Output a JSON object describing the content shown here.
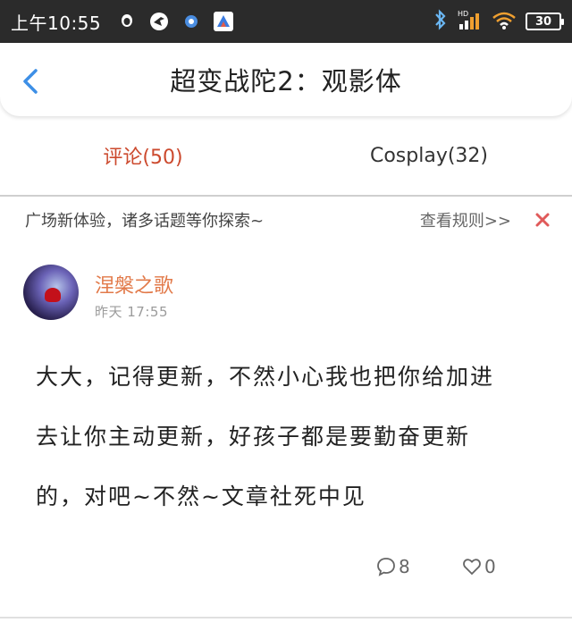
{
  "status_bar": {
    "time": "上午10:55",
    "left_icons": [
      "qq-icon",
      "bird-icon",
      "blue-dot-icon",
      "app-a-icon"
    ],
    "network_label": "HD",
    "battery": "30"
  },
  "nav": {
    "title": "超变战陀2：观影体"
  },
  "tabs": [
    {
      "label": "评论(50)",
      "active": true
    },
    {
      "label": "Cosplay(32)",
      "active": false
    }
  ],
  "notice": {
    "text": "广场新体验，诸多话题等你探索~",
    "link": "查看规则>>"
  },
  "post": {
    "username": "涅槃之歌",
    "time": "昨天 17:55",
    "lines": [
      "大大，记得更新，不然小心我也把你给加进",
      "去让你主动更新，好孩子都是要勤奋更新",
      "的，对吧~不然~文章社死中见"
    ],
    "comment_count": "8",
    "like_count": "0"
  },
  "colors": {
    "accent": "#cc4a2e",
    "username": "#e27a4a",
    "back_arrow": "#3d8fe6",
    "close_x": "#e05a5a"
  }
}
